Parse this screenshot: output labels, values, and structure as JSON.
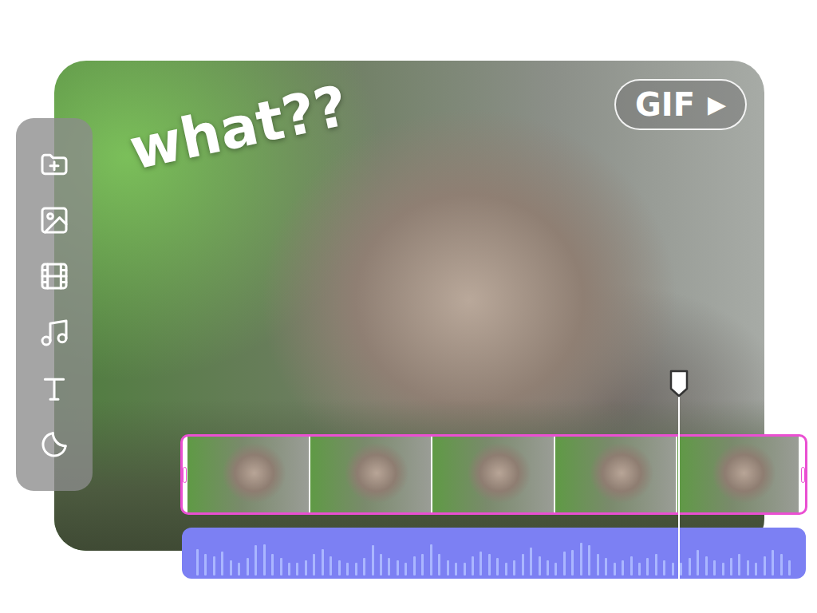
{
  "preview": {
    "overlay_text": "what??"
  },
  "badge": {
    "label": "GIF",
    "icon": "▶"
  },
  "timeline": {
    "clip": {
      "selected": true
    },
    "playhead": {
      "level": 0.797
    }
  },
  "audio": {
    "waveform": [
      0.62,
      0.5,
      0.45,
      0.55,
      0.35,
      0.3,
      0.4,
      0.7,
      0.72,
      0.5,
      0.4,
      0.3,
      0.3,
      0.35,
      0.5,
      0.62,
      0.45,
      0.35,
      0.3,
      0.3,
      0.4,
      0.7,
      0.5,
      0.4,
      0.35,
      0.3,
      0.45,
      0.5,
      0.72,
      0.5,
      0.35,
      0.3,
      0.3,
      0.45,
      0.55,
      0.5,
      0.4,
      0.3,
      0.35,
      0.5,
      0.65,
      0.45,
      0.35,
      0.3,
      0.55,
      0.6,
      0.75,
      0.7,
      0.5,
      0.4,
      0.3,
      0.35,
      0.45,
      0.3,
      0.4,
      0.5,
      0.35,
      0.3,
      0.3,
      0.4,
      0.6,
      0.45,
      0.35,
      0.3,
      0.4,
      0.5,
      0.35,
      0.3,
      0.45,
      0.6,
      0.5,
      0.35
    ]
  }
}
